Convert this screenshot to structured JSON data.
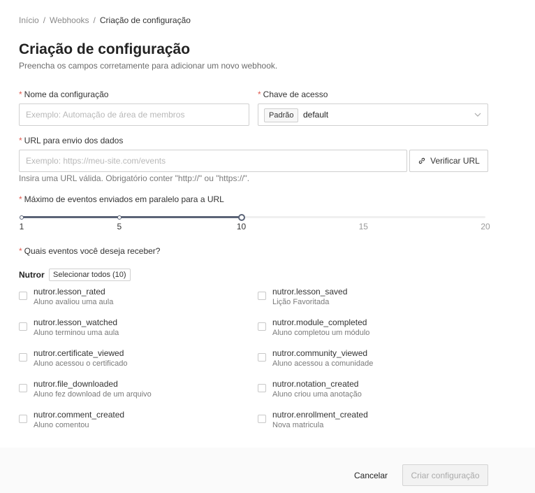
{
  "breadcrumb": {
    "items": [
      "Início",
      "Webhooks",
      "Criação de configuração"
    ],
    "separator": "/"
  },
  "header": {
    "title": "Criação de configuração",
    "subtitle": "Preencha os campos corretamente para adicionar um novo webhook."
  },
  "form": {
    "required_mark": "*",
    "name": {
      "label": "Nome da configuração",
      "placeholder": "Exemplo: Automação de área de membros",
      "value": ""
    },
    "access_key": {
      "label": "Chave de acesso",
      "tag": "Padrão",
      "value": "default"
    },
    "url": {
      "label": "URL para envio dos dados",
      "placeholder": "Exemplo: https://meu-site.com/events",
      "value": "",
      "verify_label": "Verificar URL",
      "helper": "Insira uma URL válida. Obrigatório conter \"http://\" ou \"https://\"."
    },
    "parallel": {
      "label": "Máximo de eventos enviados em paralelo para a URL",
      "min": 1,
      "max": 20,
      "value": 10,
      "marks": [
        "1",
        "5",
        "10",
        "15",
        "20"
      ]
    },
    "events": {
      "label": "Quais eventos você deseja receber?",
      "group": "Nutror",
      "select_all_label": "Selecionar todos (10)",
      "items": [
        {
          "name": "nutror.lesson_rated",
          "desc": "Aluno avaliou uma aula",
          "checked": false
        },
        {
          "name": "nutror.lesson_saved",
          "desc": "Lição Favoritada",
          "checked": false
        },
        {
          "name": "nutror.lesson_watched",
          "desc": "Aluno terminou uma aula",
          "checked": false
        },
        {
          "name": "nutror.module_completed",
          "desc": "Aluno completou um módulo",
          "checked": false
        },
        {
          "name": "nutror.certificate_viewed",
          "desc": "Aluno acessou o certificado",
          "checked": false
        },
        {
          "name": "nutror.community_viewed",
          "desc": "Aluno acessou a comunidade",
          "checked": false
        },
        {
          "name": "nutror.file_downloaded",
          "desc": "Aluno fez download de um arquivo",
          "checked": false
        },
        {
          "name": "nutror.notation_created",
          "desc": "Aluno criou uma anotação",
          "checked": false
        },
        {
          "name": "nutror.comment_created",
          "desc": "Aluno comentou",
          "checked": false
        },
        {
          "name": "nutror.enrollment_created",
          "desc": "Nova matricula",
          "checked": false
        }
      ]
    }
  },
  "footer": {
    "cancel_label": "Cancelar",
    "create_label": "Criar configuração"
  },
  "colors": {
    "required": "#e05a4f",
    "slider": "#5b6477"
  }
}
